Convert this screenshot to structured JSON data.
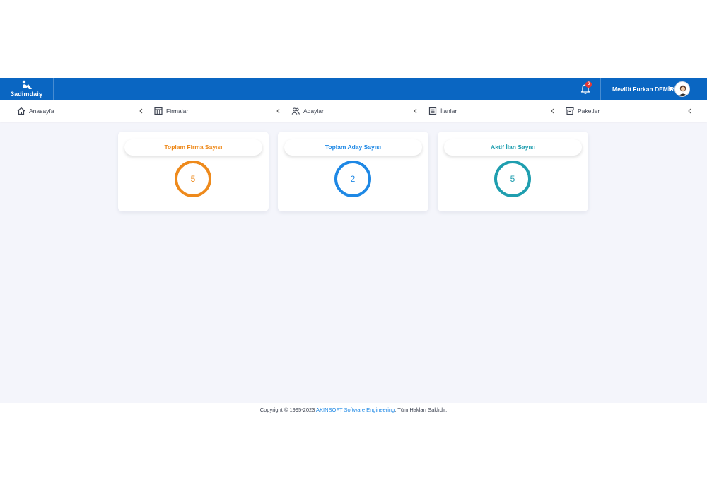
{
  "brand": {
    "name": "3adimdaiş"
  },
  "header": {
    "notification_count": "6",
    "user_name": "Mevlüt Furkan DEMİR"
  },
  "nav": {
    "items": [
      {
        "label": "Anasayfa",
        "icon": "home-icon"
      },
      {
        "label": "Firmalar",
        "icon": "table-columns-icon"
      },
      {
        "label": "Adaylar",
        "icon": "users-icon"
      },
      {
        "label": "İlanlar",
        "icon": "list-document-icon"
      },
      {
        "label": "Paketler",
        "icon": "archive-box-icon"
      }
    ]
  },
  "cards": [
    {
      "title": "Toplam Firma Sayısı",
      "value": "5",
      "color": "#ee8a1c"
    },
    {
      "title": "Toplam Aday Sayısı",
      "value": "2",
      "color": "#1e88e5"
    },
    {
      "title": "Aktif İlan Sayısı",
      "value": "5",
      "color": "#1f9eaf"
    }
  ],
  "footer": {
    "prefix": "Copyright © 1995-2023 ",
    "company": "AKINSOFT Software Engineering",
    "suffix": ". Tüm Hakları Saklıdır."
  },
  "colors": {
    "header_bg": "#0a66c2",
    "page_bg": "#f4f5fb",
    "badge": "#e53935"
  }
}
